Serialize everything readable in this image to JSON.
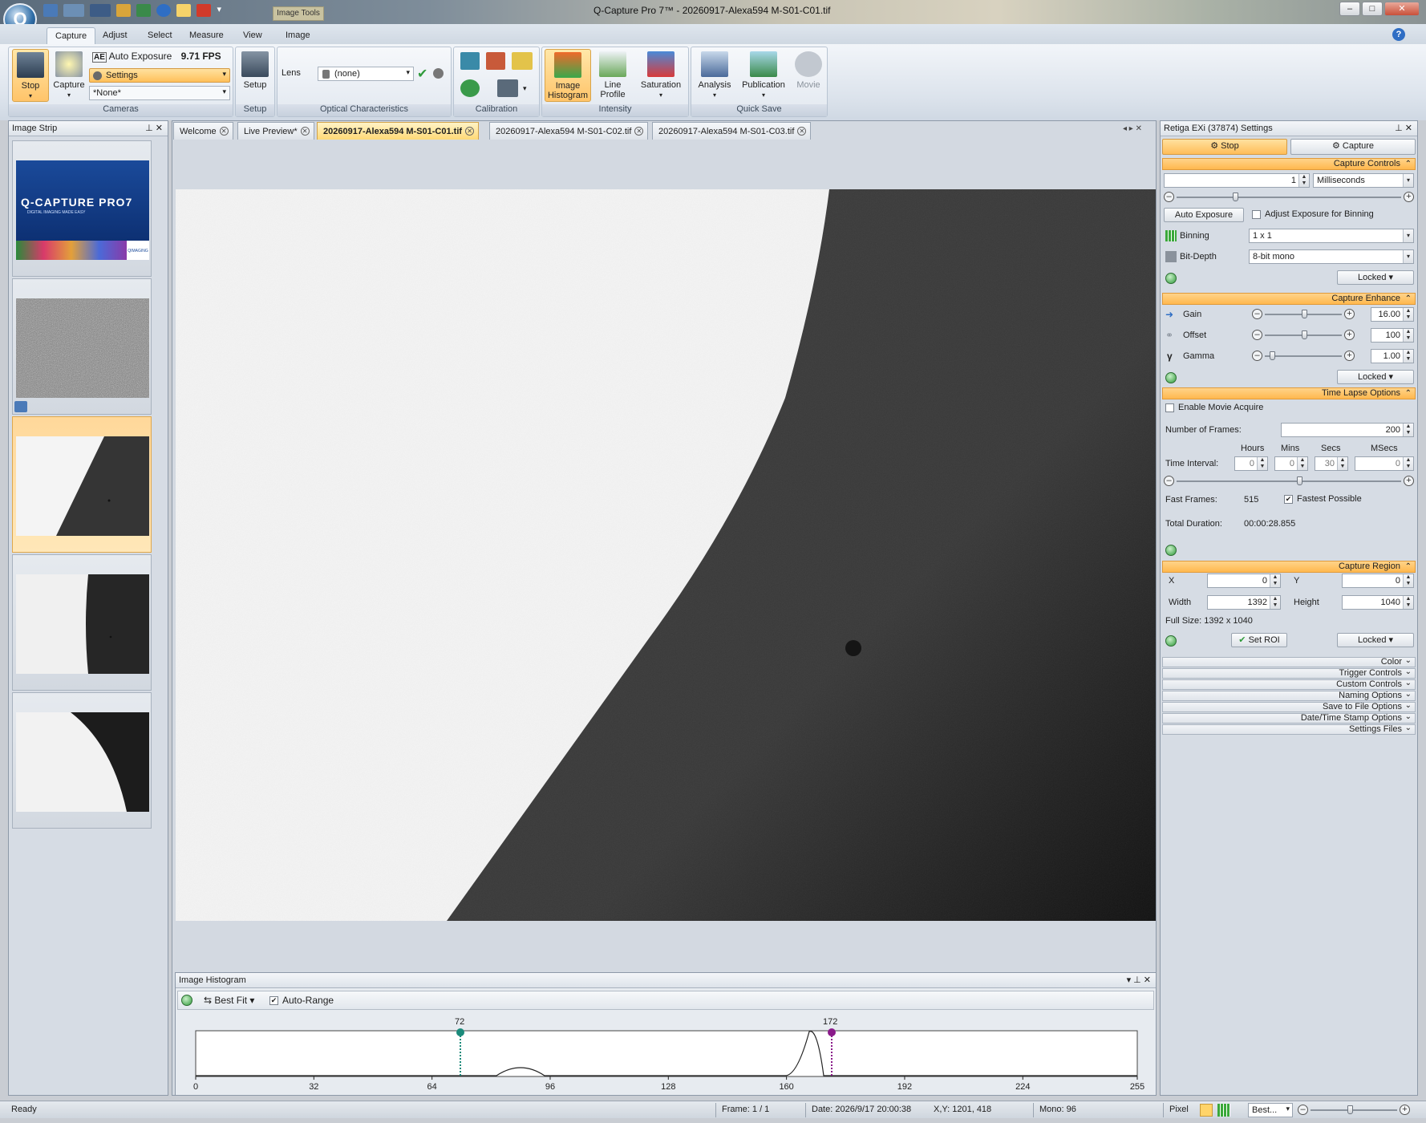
{
  "window": {
    "title": "Q-Capture Pro 7™ - 20260917-Alexa594 M-S01-C01.tif",
    "contextual_tab": "Image Tools",
    "app_logo_letter": "Q"
  },
  "ribbon": {
    "tabs": [
      "Capture",
      "Adjust",
      "Select",
      "Measure",
      "View",
      "Image"
    ],
    "active_tab": "Capture",
    "cameras": {
      "stop_label": "Stop",
      "capture_label": "Capture",
      "auto_exposure_badge": "AE",
      "auto_exposure_label": "Auto Exposure",
      "fps": "9.71 FPS",
      "settings_label": "Settings",
      "preset_value": "*None*",
      "group_label": "Cameras"
    },
    "setup": {
      "button_label": "Setup",
      "group_label": "Setup"
    },
    "optical": {
      "lens_label": "Lens",
      "lens_value": "(none)",
      "group_label": "Optical Characteristics"
    },
    "calibration": {
      "group_label": "Calibration"
    },
    "intensity": {
      "image_histogram_label_1": "Image",
      "image_histogram_label_2": "Histogram",
      "line_profile_label_1": "Line",
      "line_profile_label_2": "Profile",
      "saturation_label": "Saturation",
      "group_label": "Intensity"
    },
    "quicksave": {
      "analysis_label": "Analysis",
      "publication_label": "Publication",
      "movie_label": "Movie",
      "group_label": "Quick Save"
    }
  },
  "image_strip": {
    "title": "Image Strip",
    "splash_logo": "Q-CAPTURE PRO7",
    "splash_tagline": "DIGITAL IMAGING MADE EASY",
    "splash_brand": "QIMAGING"
  },
  "doc_tabs": [
    {
      "label": "Welcome",
      "active": false
    },
    {
      "label": "Live Preview*",
      "active": false
    },
    {
      "label": "20260917-Alexa594 M-S01-C01.tif",
      "active": true
    },
    {
      "label": "20260917-Alexa594 M-S01-C02.tif",
      "active": false
    },
    {
      "label": "20260917-Alexa594 M-S01-C03.tif",
      "active": false
    }
  ],
  "histogram": {
    "title": "Image Histogram",
    "fit_label": "Best Fit",
    "auto_range_label": "Auto-Range",
    "low_marker": "72",
    "high_marker": "172",
    "ticks": [
      "0",
      "32",
      "64",
      "96",
      "128",
      "160",
      "192",
      "224",
      "255"
    ]
  },
  "settings_panel": {
    "title": "Retiga EXi (37874) Settings",
    "stop_label": "Stop",
    "capture_label": "Capture",
    "capture_controls": {
      "header": "Capture Controls",
      "exposure_value": "1",
      "exposure_unit": "Milliseconds",
      "auto_exposure_button": "Auto Exposure",
      "adjust_binning_label": "Adjust Exposure for Binning",
      "binning_label": "Binning",
      "binning_value": "1 x 1",
      "bitdepth_label": "Bit-Depth",
      "bitdepth_value": "8-bit mono",
      "locked_label": "Locked"
    },
    "capture_enhance": {
      "header": "Capture Enhance",
      "gain_label": "Gain",
      "gain_value": "16.00",
      "offset_label": "Offset",
      "offset_value": "100",
      "gamma_label": "Gamma",
      "gamma_value": "1.00",
      "locked_label": "Locked"
    },
    "time_lapse": {
      "header": "Time Lapse Options",
      "enable_movie_label": "Enable Movie Acquire",
      "frames_label": "Number of  Frames:",
      "frames_value": "200",
      "hours_label": "Hours",
      "mins_label": "Mins",
      "secs_label": "Secs",
      "msecs_label": "MSecs",
      "interval_label": "Time Interval:",
      "hours_value": "0",
      "mins_value": "0",
      "secs_value": "30",
      "msecs_value": "0",
      "fast_frames_label": "Fast Frames:",
      "fast_frames_value": "515",
      "fastest_possible_label": "Fastest Possible",
      "total_duration_label": "Total Duration:",
      "total_duration_value": "00:00:28.855"
    },
    "capture_region": {
      "header": "Capture Region",
      "x_label": "X",
      "x_value": "0",
      "y_label": "Y",
      "y_value": "0",
      "width_label": "Width",
      "width_value": "1392",
      "height_label": "Height",
      "height_value": "1040",
      "full_size": "Full Size: 1392 x 1040",
      "set_roi_label": "Set ROI",
      "locked_label": "Locked"
    },
    "collapsed_sections": [
      "Color",
      "Trigger Controls",
      "Custom Controls",
      "Naming Options",
      "Save to File Options",
      "Date/Time Stamp Options",
      "Settings Files"
    ]
  },
  "statusbar": {
    "ready": "Ready",
    "frame": "Frame: 1 / 1",
    "date": "Date: 2026/9/17 20:00:38",
    "xy": "X,Y: 1201,  418",
    "mono": "Mono:   96",
    "pixel": "Pixel",
    "zoom": "Best..."
  }
}
